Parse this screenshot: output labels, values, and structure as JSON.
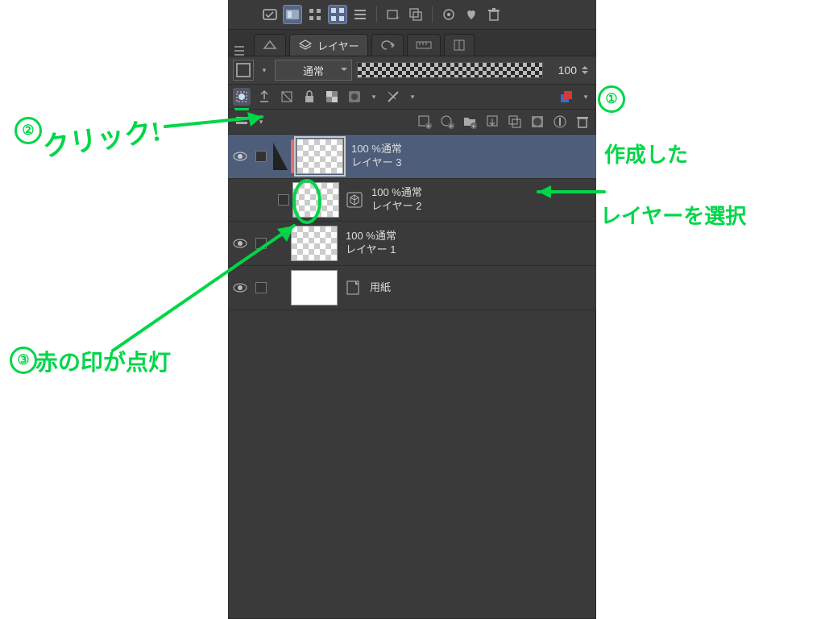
{
  "toolbar": {
    "items": [
      "check-list",
      "window-card",
      "grid-small",
      "grid-large",
      "list",
      "pipe",
      "frame-add",
      "frame-copy",
      "pipe",
      "settings",
      "heart",
      "trash"
    ]
  },
  "tabs": {
    "label": "レイヤー"
  },
  "options": {
    "blend_mode": "通常",
    "opacity": "100"
  },
  "layers": [
    {
      "id": "layer3",
      "opacity": "100 %通常",
      "name": "レイヤー 3",
      "selected": true,
      "trans": true,
      "red": true
    },
    {
      "id": "layer2",
      "opacity": "100 %通常",
      "name": "レイヤー 2",
      "child": true,
      "trans": true,
      "icon": "3d"
    },
    {
      "id": "layer1",
      "opacity": "100 %通常",
      "name": "レイヤー 1",
      "trans": true
    },
    {
      "id": "paper",
      "opacity": "",
      "name": "用紙",
      "icon": "paper"
    }
  ],
  "annotations": {
    "n1": "①",
    "t1a": "作成した",
    "t1b": "レイヤーを選択",
    "n2": "②",
    "t2": "クリック!",
    "n3": "③",
    "t3": "赤の印が点灯"
  }
}
